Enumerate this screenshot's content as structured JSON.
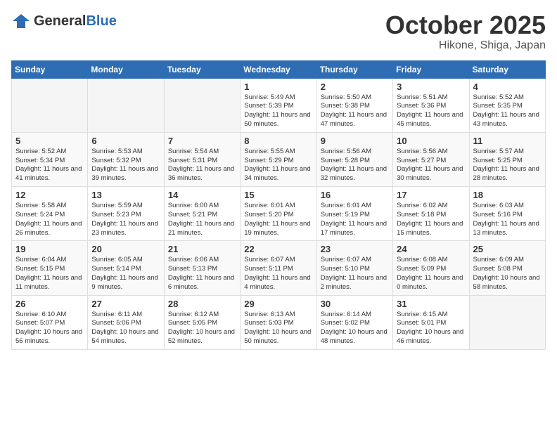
{
  "header": {
    "logo_general": "General",
    "logo_blue": "Blue",
    "month": "October 2025",
    "location": "Hikone, Shiga, Japan"
  },
  "weekdays": [
    "Sunday",
    "Monday",
    "Tuesday",
    "Wednesday",
    "Thursday",
    "Friday",
    "Saturday"
  ],
  "weeks": [
    [
      {
        "day": "",
        "sunrise": "",
        "sunset": "",
        "daylight": ""
      },
      {
        "day": "",
        "sunrise": "",
        "sunset": "",
        "daylight": ""
      },
      {
        "day": "",
        "sunrise": "",
        "sunset": "",
        "daylight": ""
      },
      {
        "day": "1",
        "sunrise": "Sunrise: 5:49 AM",
        "sunset": "Sunset: 5:39 PM",
        "daylight": "Daylight: 11 hours and 50 minutes."
      },
      {
        "day": "2",
        "sunrise": "Sunrise: 5:50 AM",
        "sunset": "Sunset: 5:38 PM",
        "daylight": "Daylight: 11 hours and 47 minutes."
      },
      {
        "day": "3",
        "sunrise": "Sunrise: 5:51 AM",
        "sunset": "Sunset: 5:36 PM",
        "daylight": "Daylight: 11 hours and 45 minutes."
      },
      {
        "day": "4",
        "sunrise": "Sunrise: 5:52 AM",
        "sunset": "Sunset: 5:35 PM",
        "daylight": "Daylight: 11 hours and 43 minutes."
      }
    ],
    [
      {
        "day": "5",
        "sunrise": "Sunrise: 5:52 AM",
        "sunset": "Sunset: 5:34 PM",
        "daylight": "Daylight: 11 hours and 41 minutes."
      },
      {
        "day": "6",
        "sunrise": "Sunrise: 5:53 AM",
        "sunset": "Sunset: 5:32 PM",
        "daylight": "Daylight: 11 hours and 39 minutes."
      },
      {
        "day": "7",
        "sunrise": "Sunrise: 5:54 AM",
        "sunset": "Sunset: 5:31 PM",
        "daylight": "Daylight: 11 hours and 36 minutes."
      },
      {
        "day": "8",
        "sunrise": "Sunrise: 5:55 AM",
        "sunset": "Sunset: 5:29 PM",
        "daylight": "Daylight: 11 hours and 34 minutes."
      },
      {
        "day": "9",
        "sunrise": "Sunrise: 5:56 AM",
        "sunset": "Sunset: 5:28 PM",
        "daylight": "Daylight: 11 hours and 32 minutes."
      },
      {
        "day": "10",
        "sunrise": "Sunrise: 5:56 AM",
        "sunset": "Sunset: 5:27 PM",
        "daylight": "Daylight: 11 hours and 30 minutes."
      },
      {
        "day": "11",
        "sunrise": "Sunrise: 5:57 AM",
        "sunset": "Sunset: 5:25 PM",
        "daylight": "Daylight: 11 hours and 28 minutes."
      }
    ],
    [
      {
        "day": "12",
        "sunrise": "Sunrise: 5:58 AM",
        "sunset": "Sunset: 5:24 PM",
        "daylight": "Daylight: 11 hours and 26 minutes."
      },
      {
        "day": "13",
        "sunrise": "Sunrise: 5:59 AM",
        "sunset": "Sunset: 5:23 PM",
        "daylight": "Daylight: 11 hours and 23 minutes."
      },
      {
        "day": "14",
        "sunrise": "Sunrise: 6:00 AM",
        "sunset": "Sunset: 5:21 PM",
        "daylight": "Daylight: 11 hours and 21 minutes."
      },
      {
        "day": "15",
        "sunrise": "Sunrise: 6:01 AM",
        "sunset": "Sunset: 5:20 PM",
        "daylight": "Daylight: 11 hours and 19 minutes."
      },
      {
        "day": "16",
        "sunrise": "Sunrise: 6:01 AM",
        "sunset": "Sunset: 5:19 PM",
        "daylight": "Daylight: 11 hours and 17 minutes."
      },
      {
        "day": "17",
        "sunrise": "Sunrise: 6:02 AM",
        "sunset": "Sunset: 5:18 PM",
        "daylight": "Daylight: 11 hours and 15 minutes."
      },
      {
        "day": "18",
        "sunrise": "Sunrise: 6:03 AM",
        "sunset": "Sunset: 5:16 PM",
        "daylight": "Daylight: 11 hours and 13 minutes."
      }
    ],
    [
      {
        "day": "19",
        "sunrise": "Sunrise: 6:04 AM",
        "sunset": "Sunset: 5:15 PM",
        "daylight": "Daylight: 11 hours and 11 minutes."
      },
      {
        "day": "20",
        "sunrise": "Sunrise: 6:05 AM",
        "sunset": "Sunset: 5:14 PM",
        "daylight": "Daylight: 11 hours and 9 minutes."
      },
      {
        "day": "21",
        "sunrise": "Sunrise: 6:06 AM",
        "sunset": "Sunset: 5:13 PM",
        "daylight": "Daylight: 11 hours and 6 minutes."
      },
      {
        "day": "22",
        "sunrise": "Sunrise: 6:07 AM",
        "sunset": "Sunset: 5:11 PM",
        "daylight": "Daylight: 11 hours and 4 minutes."
      },
      {
        "day": "23",
        "sunrise": "Sunrise: 6:07 AM",
        "sunset": "Sunset: 5:10 PM",
        "daylight": "Daylight: 11 hours and 2 minutes."
      },
      {
        "day": "24",
        "sunrise": "Sunrise: 6:08 AM",
        "sunset": "Sunset: 5:09 PM",
        "daylight": "Daylight: 11 hours and 0 minutes."
      },
      {
        "day": "25",
        "sunrise": "Sunrise: 6:09 AM",
        "sunset": "Sunset: 5:08 PM",
        "daylight": "Daylight: 10 hours and 58 minutes."
      }
    ],
    [
      {
        "day": "26",
        "sunrise": "Sunrise: 6:10 AM",
        "sunset": "Sunset: 5:07 PM",
        "daylight": "Daylight: 10 hours and 56 minutes."
      },
      {
        "day": "27",
        "sunrise": "Sunrise: 6:11 AM",
        "sunset": "Sunset: 5:06 PM",
        "daylight": "Daylight: 10 hours and 54 minutes."
      },
      {
        "day": "28",
        "sunrise": "Sunrise: 6:12 AM",
        "sunset": "Sunset: 5:05 PM",
        "daylight": "Daylight: 10 hours and 52 minutes."
      },
      {
        "day": "29",
        "sunrise": "Sunrise: 6:13 AM",
        "sunset": "Sunset: 5:03 PM",
        "daylight": "Daylight: 10 hours and 50 minutes."
      },
      {
        "day": "30",
        "sunrise": "Sunrise: 6:14 AM",
        "sunset": "Sunset: 5:02 PM",
        "daylight": "Daylight: 10 hours and 48 minutes."
      },
      {
        "day": "31",
        "sunrise": "Sunrise: 6:15 AM",
        "sunset": "Sunset: 5:01 PM",
        "daylight": "Daylight: 10 hours and 46 minutes."
      },
      {
        "day": "",
        "sunrise": "",
        "sunset": "",
        "daylight": ""
      }
    ]
  ]
}
